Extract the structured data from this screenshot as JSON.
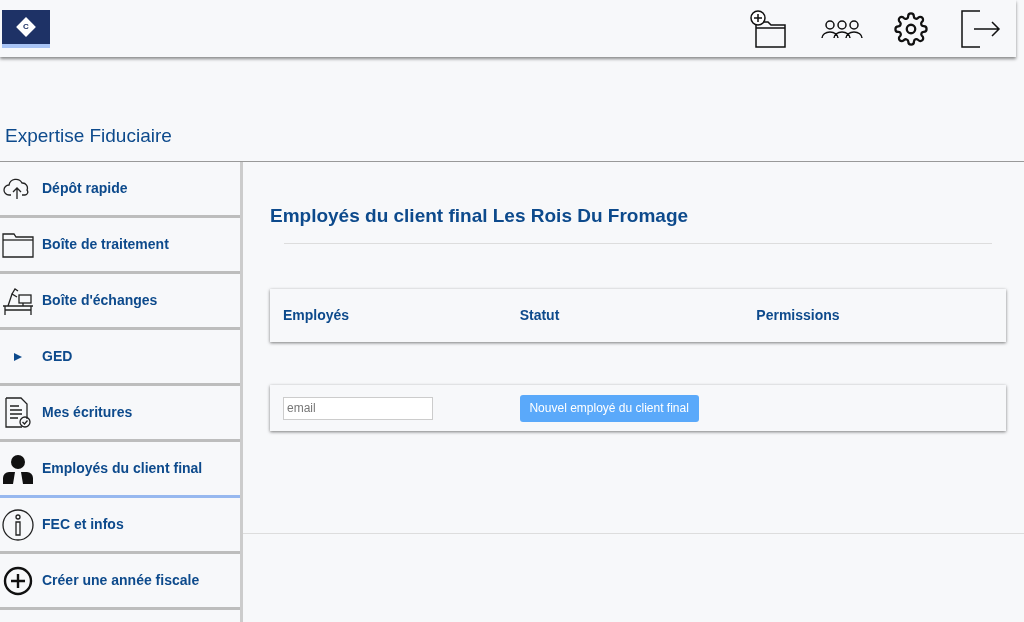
{
  "header": {
    "logo_letter": "C",
    "actions": [
      {
        "kind": "folder-add"
      },
      {
        "kind": "users"
      },
      {
        "kind": "settings"
      },
      {
        "kind": "logout"
      }
    ]
  },
  "firm_title": "Expertise Fiduciaire",
  "sidebar": {
    "items": [
      {
        "kind": "cloud",
        "label": "Dépôt rapide",
        "selected": false
      },
      {
        "kind": "folder",
        "label": "Boîte de traitement",
        "selected": false
      },
      {
        "kind": "desk",
        "label": "Boîte d'échanges",
        "selected": false
      },
      {
        "kind": "triangle",
        "label": "GED",
        "selected": false
      },
      {
        "kind": "document",
        "label": "Mes écritures",
        "selected": false
      },
      {
        "kind": "person",
        "label": "Employés du client final",
        "selected": true
      },
      {
        "kind": "info",
        "label": "FEC et infos",
        "selected": false
      },
      {
        "kind": "plus",
        "label": "Créer une année fiscale",
        "selected": false
      }
    ]
  },
  "main": {
    "title": "Employés du client final Les Rois Du Fromage",
    "table": {
      "columns": [
        "Employés",
        "Statut",
        "Permissions"
      ]
    },
    "new_employee": {
      "placeholder": "email",
      "button": "Nouvel employé du client final"
    }
  }
}
